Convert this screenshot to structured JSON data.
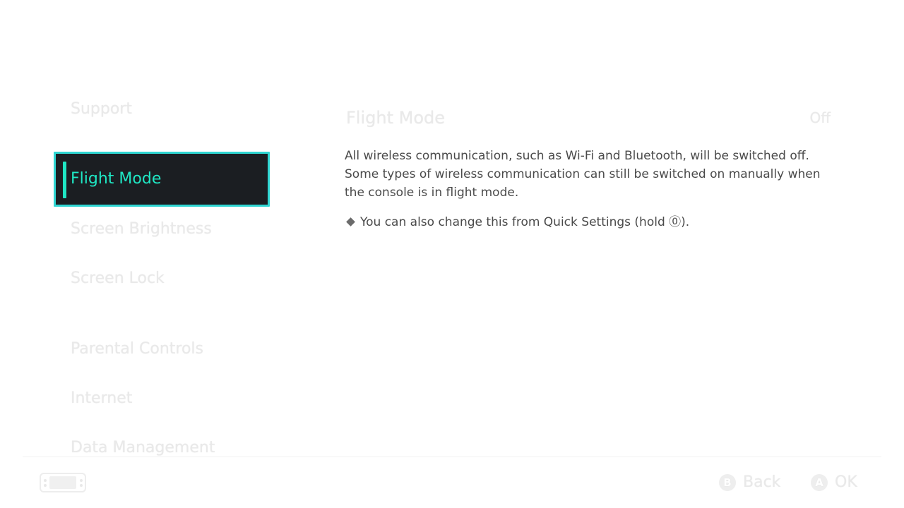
{
  "sidebar": {
    "items": [
      {
        "label": "Support"
      },
      {
        "label": "Flight Mode",
        "selected": true
      },
      {
        "label": "Screen Brightness"
      },
      {
        "label": "Screen Lock"
      },
      {
        "label": "Parental Controls"
      },
      {
        "label": "Internet"
      },
      {
        "label": "Data Management"
      }
    ]
  },
  "content": {
    "title": "Flight Mode",
    "value": "Off",
    "description": [
      "All wireless communication, such as Wi-Fi and Bluetooth, will be switched off.",
      "Some types of wireless communication can still be switched on manually when",
      "the console is in flight mode."
    ],
    "note": "You can also change this from Quick Settings (hold ",
    "note_glyph": "⓪",
    "note_end": ")."
  },
  "footer": {
    "back_key": "B",
    "back_label": "Back",
    "ok_key": "A",
    "ok_label": "OK"
  },
  "colors": {
    "accent": "#1fe7c4",
    "frame": "#2fd6d2",
    "selected_bg": "#1b1e22"
  }
}
